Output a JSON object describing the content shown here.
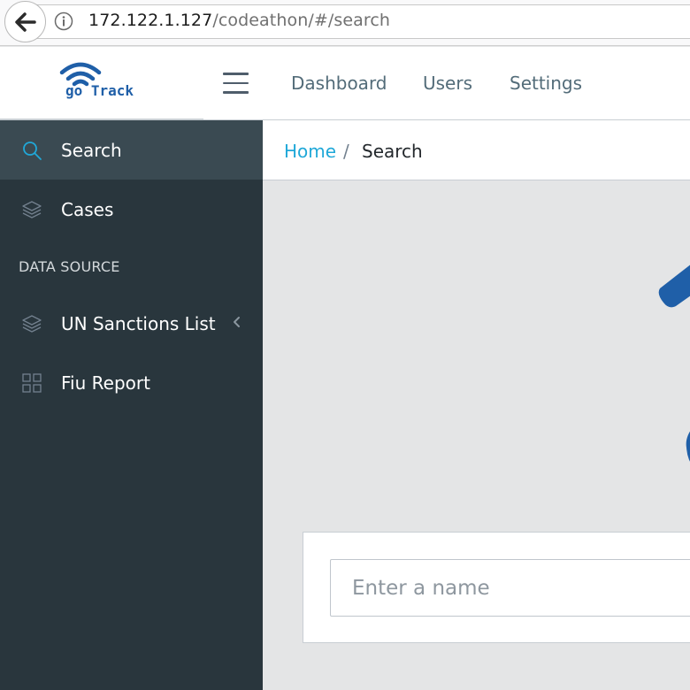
{
  "browser": {
    "url_host": "172.122.1.127",
    "url_path": "/codeathon/#/search"
  },
  "header": {
    "logo_text": "go Track",
    "nav": [
      {
        "label": "Dashboard"
      },
      {
        "label": "Users"
      },
      {
        "label": "Settings"
      }
    ]
  },
  "sidebar": {
    "items": [
      {
        "label": "Search",
        "icon": "search-icon",
        "active": true
      },
      {
        "label": "Cases",
        "icon": "layers-icon",
        "active": false
      }
    ],
    "section_title": "DATA SOURCE",
    "data_sources": [
      {
        "label": "UN Sanctions List",
        "icon": "layers-icon"
      },
      {
        "label": "Fiu Report",
        "icon": "grid-icon"
      }
    ]
  },
  "breadcrumb": {
    "home": "Home",
    "separator": "/",
    "current": "Search"
  },
  "search": {
    "placeholder": "Enter a name"
  },
  "colors": {
    "sidebar_bg": "#29363d",
    "sidebar_active": "#3a4a52",
    "accent": "#20a8d8",
    "brand_blue": "#1f5fa8"
  }
}
